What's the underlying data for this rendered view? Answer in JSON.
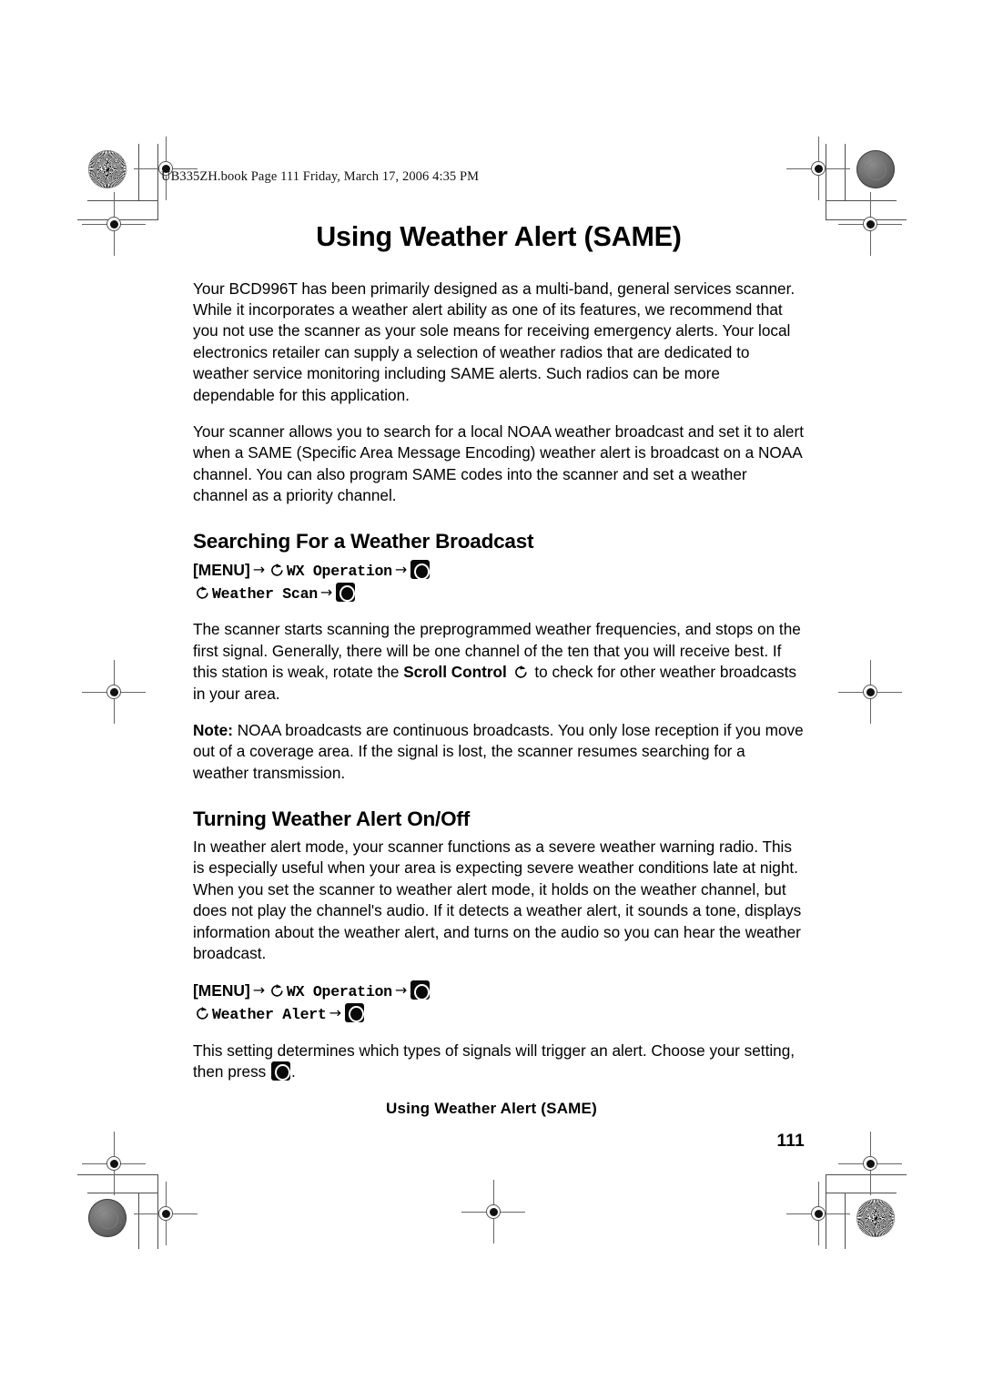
{
  "print_header": {
    "text": "UB335ZH.book  Page 111  Friday, March 17, 2006  4:35 PM"
  },
  "document": {
    "title": "Using Weather Alert (SAME)",
    "intro_paragraph_1": "Your BCD996T has been primarily designed as a multi-band, general services scanner. While it incorporates a weather alert ability as one of its features, we recommend that you not use the scanner as your sole means for receiving emergency alerts. Your local electronics retailer can supply a selection of weather radios that are dedicated to weather service monitoring including SAME alerts. Such radios can be more dependable for this application.",
    "intro_paragraph_2": "Your scanner allows you to search for a local NOAA weather broadcast and set it to alert when a SAME (Specific Area Message Encoding) weather alert is broadcast on a NOAA channel. You can also program SAME codes into the scanner and set a weather channel as a priority channel."
  },
  "section_search": {
    "heading": "Searching For a Weather Broadcast",
    "menu_path": {
      "menu_label": "[MENU]",
      "step_1": "WX Operation",
      "step_2": "Weather Scan"
    },
    "paragraph_before_bold": "The scanner starts scanning the preprogrammed weather frequencies, and stops on the first signal. Generally, there will be one channel of the ten that you will receive best. If this station is weak, rotate the ",
    "paragraph_bold": "Scroll Control",
    "paragraph_after_bold": " to check for other weather broadcasts in your area.",
    "note_label": "Note:",
    "note_text": " NOAA broadcasts are continuous broadcasts. You only lose reception if you move out of a coverage area. If the signal is lost, the scanner resumes searching for a weather transmission."
  },
  "section_alert": {
    "heading": "Turning Weather Alert On/Off",
    "paragraph": "In weather alert mode, your scanner functions as a severe weather warning radio. This is especially useful when your area is expecting severe weather conditions late at night. When you set the scanner to weather alert mode, it holds on the weather channel, but does not play the channel's audio. If it detects a weather alert, it sounds a tone, displays information about the weather alert, and turns on the audio so you can hear the weather broadcast.",
    "menu_path": {
      "menu_label": "[MENU]",
      "step_1": "WX Operation",
      "step_2": "Weather Alert"
    },
    "closing_text_before_key": "This setting determines which types of signals will trigger an alert. Choose your setting, then press ",
    "closing_text_after_key": "."
  },
  "footer": {
    "running_title": "Using Weather Alert (SAME)",
    "page_number": "111"
  },
  "icons": {
    "arrow": "→",
    "scroll_control": "scroll-control-icon",
    "enter_key": "enter-key-icon"
  },
  "colors": {
    "text": "#000000",
    "page_background": "#ffffff",
    "key_icon_background": "#0a0a0a",
    "registration_mark": "#4d4d4d"
  }
}
